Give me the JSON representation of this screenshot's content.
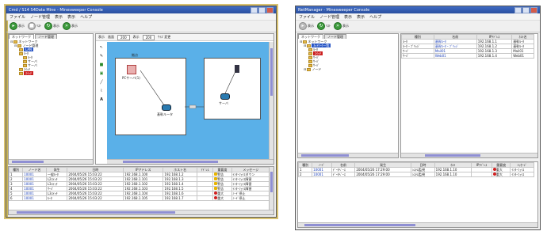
{
  "left": {
    "title": "Cmd / S14 S4Data Mine - Minesweeper Console",
    "menu": [
      "ファイル",
      "ノード管理",
      "表示",
      "表示",
      "ヘルプ"
    ],
    "toolbar": [
      "表示",
      "ﾘｽﾄ",
      "表示",
      "表示"
    ],
    "tabs": [
      "ネットワーク",
      "ノード管理"
    ],
    "tree": [
      {
        "label": "ネットワーク",
        "indent": 0,
        "style": ""
      },
      {
        "label": "ノード管理",
        "indent": 1,
        "style": ""
      },
      {
        "label": "LAN",
        "indent": 2,
        "style": "blue"
      },
      {
        "label": "ﾙｰﾀ",
        "indent": 2,
        "style": ""
      },
      {
        "label": "ﾙｰﾀ",
        "indent": 3,
        "style": ""
      },
      {
        "label": "サーバ",
        "indent": 3,
        "style": ""
      },
      {
        "label": "サーバ",
        "indent": 3,
        "style": ""
      },
      {
        "label": "ｽｲｯﾁ",
        "indent": 2,
        "style": ""
      },
      {
        "label": "ｽｲｯﾁ",
        "indent": 2,
        "style": "red"
      }
    ],
    "map_toolbar": [
      "表示",
      "画面",
      "200",
      "表示",
      "200",
      "ｻｲｽﾞ変更"
    ],
    "map_label": "拠点",
    "node_labels": [
      "PCサーバ(1)",
      "基幹ルータ",
      "サーバ"
    ],
    "grid_headers": [
      "種別",
      "ノード名",
      "発生",
      "日時",
      "IPアドレス",
      "ホスト名",
      "ｱﾄﾞﾚｽ",
      "重要度",
      "メッセージ"
    ],
    "rows": [
      [
        "1",
        "10001",
        "一般ﾙｰﾀ",
        "2004/05/26 15:03:22",
        "192.168.1.100",
        "192.168.1.2",
        "",
        "警告",
        "ｲﾝﾀｰﾌｪｲｽダウン"
      ],
      [
        "2",
        "10001",
        "L2ｽｲｯﾁ",
        "2004/05/26 15:03:22",
        "192.168.1.101",
        "192.168.1.3",
        "",
        "警告",
        "ｲﾝﾀｰﾌｪｲｽ障害"
      ],
      [
        "3",
        "10001",
        "L3ｽｲｯﾁ",
        "2004/05/26 15:03:22",
        "192.168.1.102",
        "192.168.1.4",
        "",
        "警告",
        "ｲﾝﾀｰﾌｪｲｽ障害"
      ],
      [
        "4",
        "10001",
        "ｻｰﾊﾞ",
        "2004/05/26 15:03:22",
        "192.168.1.103",
        "192.168.1.5",
        "",
        "警告",
        "ｲﾝﾀｰﾌｪｲｽ障害"
      ],
      [
        "5",
        "10001",
        "L3ｽｲｯﾁ",
        "2004/05/26 15:03:22",
        "192.168.1.104",
        "192.168.1.6",
        "",
        "重大",
        "ﾉｰﾄﾞ停止"
      ],
      [
        "6",
        "10001",
        "ﾙｰﾀ",
        "2004/05/26 15:03:22",
        "192.168.1.105",
        "192.168.1.7",
        "",
        "重大",
        "ﾉｰﾄﾞ停止"
      ]
    ]
  },
  "right": {
    "title": "NetManager - Minesweeper Console",
    "menu": [
      "ファイル",
      "ノード管理",
      "表示",
      "表示",
      "ヘルプ"
    ],
    "toolbar": [
      "表示",
      "ﾘｽﾄ",
      "表示"
    ],
    "tabs": [
      "ネットワーク",
      "ノード管理"
    ],
    "tree": [
      {
        "label": "ネットワーク",
        "indent": 0,
        "style": ""
      },
      {
        "label": "ﾈｯﾄﾜｰｸ一覧",
        "indent": 1,
        "style": "blue"
      },
      {
        "label": "ﾙｰﾀ",
        "indent": 2,
        "style": ""
      },
      {
        "label": "ｽｲｯﾁ",
        "indent": 2,
        "style": "red"
      },
      {
        "label": "ｻｰﾊﾞ",
        "indent": 2,
        "style": ""
      },
      {
        "label": "ｻｰﾊﾞ",
        "indent": 2,
        "style": ""
      },
      {
        "label": "ｻｰﾊﾞ",
        "indent": 2,
        "style": ""
      },
      {
        "label": "ノード",
        "indent": 1,
        "style": ""
      }
    ],
    "list_headers": [
      "種別",
      "名前",
      "IPｱﾄﾞﾚｽ",
      "ﾎｽﾄ名"
    ],
    "list_rows": [
      [
        "ﾙｰﾀ",
        "基幹ﾙｰﾀ",
        "192.168.1.1",
        "基幹ﾙｰﾀ"
      ],
      [
        "ﾙｰﾀ・ﾌﾞﾘｯｼﾞ",
        "基幹ﾙｰﾀ・ﾌﾞﾘｯｼﾞ",
        "192.168.1.2",
        "基幹ﾙｰﾀ"
      ],
      [
        "ｻｰﾊﾞ",
        "Mail01",
        "192.168.1.3",
        "Mail01"
      ],
      [
        "ｻｰﾊﾞ",
        "Web01",
        "192.168.1.4",
        "Web01"
      ]
    ],
    "grid_headers": [
      "種別",
      "ﾉｰﾄﾞ",
      "名前",
      "発生",
      "日時",
      "ﾎｽﾄ",
      "IPｱﾄﾞﾚｽ",
      "重要度",
      "ﾒｯｾｰｼﾞ"
    ],
    "rows": [
      [
        "1",
        "10001",
        "ﾃﾞｰﾀﾍﾞｰｽ",
        "2004/05/26 17:29:00",
        "ｼｽﾃﾑ監視",
        "192.168.1.10",
        "",
        "重大",
        "ｲﾝﾀｰﾌｪｲｽ"
      ],
      [
        "2",
        "10001",
        "ﾃﾞｰﾀﾍﾞｰｽ",
        "2004/05/26 17:29:00",
        "ｼｽﾃﾑ監視",
        "192.168.1.10",
        "",
        "重大",
        "ｲﾝﾀｰﾌｪｲｽ"
      ]
    ]
  }
}
